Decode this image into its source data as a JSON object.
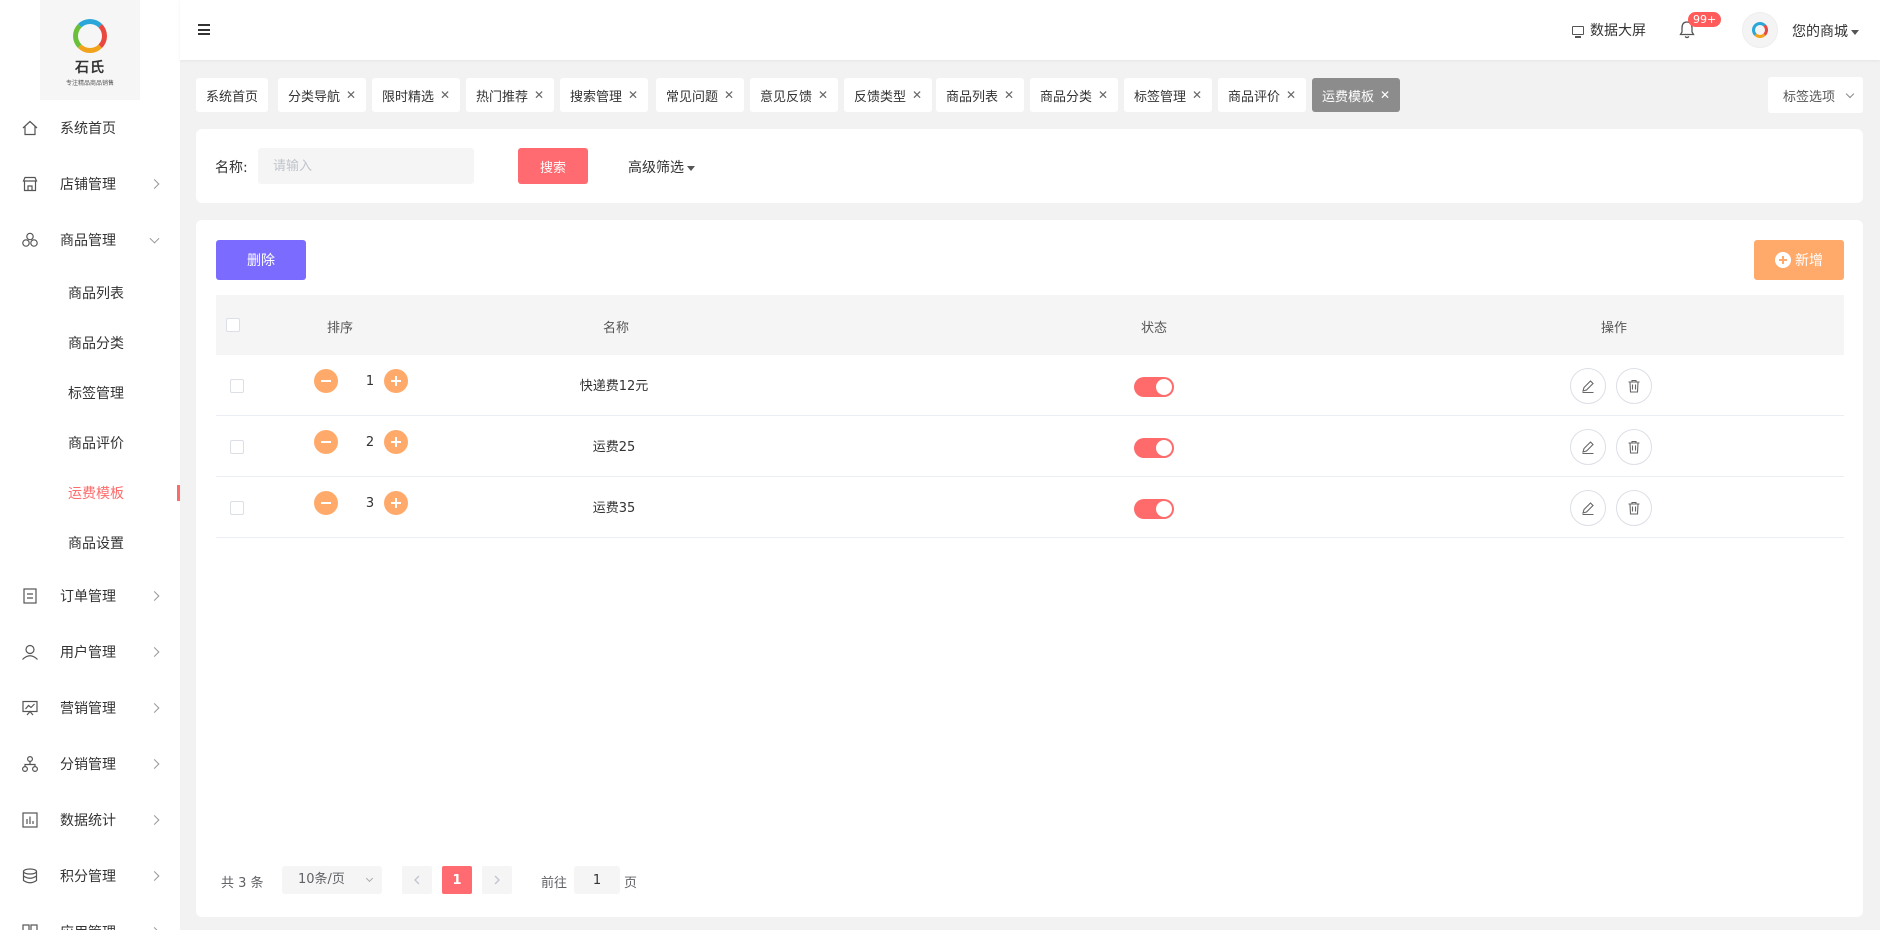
{
  "brand": {
    "name": "石氏",
    "slogan": "专注精品商品销售"
  },
  "sidebar": {
    "items": [
      {
        "label": "系统首页",
        "icon": "home-icon",
        "arrow": false
      },
      {
        "label": "店铺管理",
        "icon": "shop-icon",
        "arrow": "right"
      },
      {
        "label": "商品管理",
        "icon": "goods-icon",
        "arrow": "down"
      }
    ],
    "sub_items": [
      "商品列表",
      "商品分类",
      "标签管理",
      "商品评价",
      "运费模板",
      "商品设置"
    ],
    "active_sub": "运费模板",
    "items_after": [
      {
        "label": "订单管理",
        "icon": "order-icon"
      },
      {
        "label": "用户管理",
        "icon": "user-icon"
      },
      {
        "label": "营销管理",
        "icon": "marketing-icon"
      },
      {
        "label": "分销管理",
        "icon": "distribution-icon"
      },
      {
        "label": "数据统计",
        "icon": "stats-icon"
      },
      {
        "label": "积分管理",
        "icon": "points-icon"
      },
      {
        "label": "应用管理",
        "icon": "app-icon"
      }
    ]
  },
  "header": {
    "big_screen_label": "数据大屏",
    "notification_badge": "99+",
    "shop_name": "您的商城"
  },
  "tags": [
    {
      "label": "系统首页",
      "closable": false
    },
    {
      "label": "分类导航",
      "closable": true
    },
    {
      "label": "限时精选",
      "closable": true
    },
    {
      "label": "热门推荐",
      "closable": true
    },
    {
      "label": "搜索管理",
      "closable": true
    },
    {
      "label": "常见问题",
      "closable": true
    },
    {
      "label": "意见反馈",
      "closable": true
    },
    {
      "label": "反馈类型",
      "closable": true
    },
    {
      "label": "商品列表",
      "closable": true
    },
    {
      "label": "商品分类",
      "closable": true
    },
    {
      "label": "标签管理",
      "closable": true
    },
    {
      "label": "商品评价",
      "closable": true
    },
    {
      "label": "运费模板",
      "closable": true,
      "active": true
    }
  ],
  "tag_options_label": "标签选项",
  "search": {
    "label": "名称:",
    "placeholder": "请输入",
    "value": "",
    "button": "搜索",
    "advanced": "高级筛选"
  },
  "toolbar": {
    "delete_label": "删除",
    "add_label": "新增"
  },
  "table": {
    "columns": [
      "排序",
      "名称",
      "状态",
      "操作"
    ],
    "rows": [
      {
        "sort": "1",
        "name": "快递费12元",
        "enabled": true
      },
      {
        "sort": "2",
        "name": "运费25",
        "enabled": true
      },
      {
        "sort": "3",
        "name": "运费35",
        "enabled": true
      }
    ]
  },
  "pagination": {
    "total_text": "共 3 条",
    "page_size": "10条/页",
    "current_page": "1",
    "goto_label": "前往",
    "goto_value": "1",
    "page_suffix": "页"
  },
  "colors": {
    "accent": "#ff6b6b",
    "delete_button": "#7b6cff",
    "add_button": "#ffaa6b",
    "active_tag": "#8c8c8c"
  }
}
